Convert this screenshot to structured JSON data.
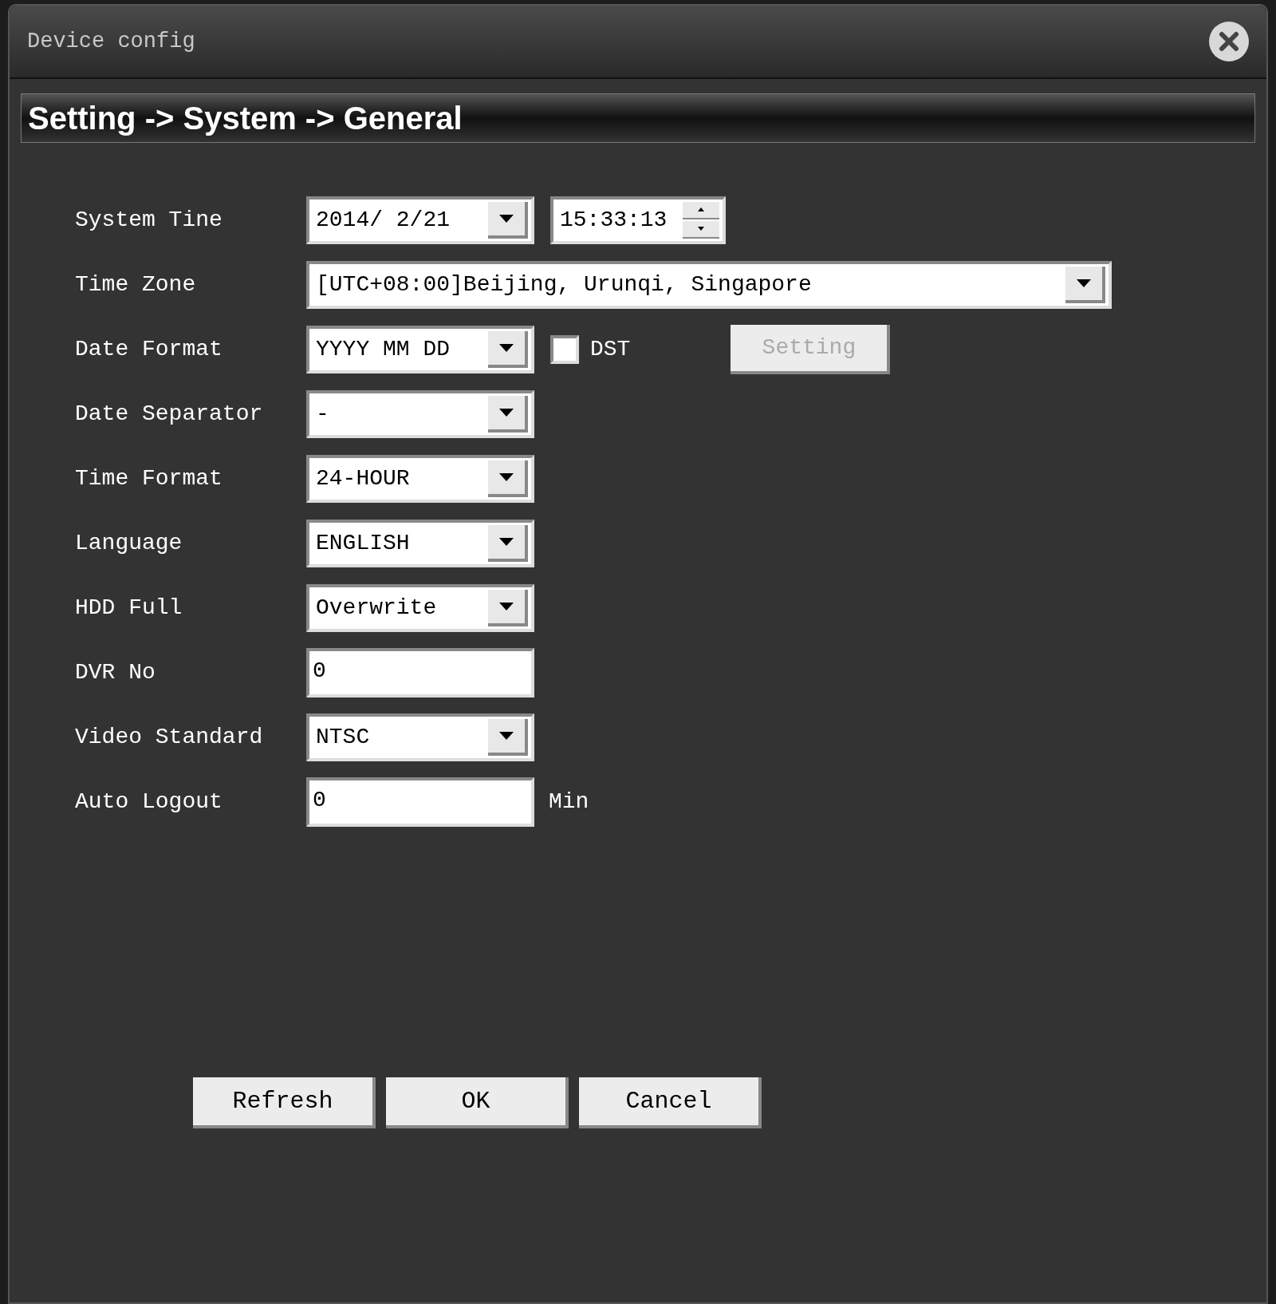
{
  "window": {
    "title": "Device config"
  },
  "header": "Setting -> System -> General",
  "rows": [
    {
      "label": "System Tine",
      "controls": [
        {
          "kind": "dropdown",
          "value": "2014/ 2/21"
        },
        {
          "kind": "spinner",
          "value": "15:33:13"
        }
      ]
    },
    {
      "label": "Time Zone",
      "controls": [
        {
          "kind": "wide-dropdown",
          "value": "[UTC+08:00]Beijing, Urunqi, Singapore"
        }
      ]
    },
    {
      "label": "Date Format",
      "controls": [
        {
          "kind": "dropdown",
          "value": "YYYY MM DD"
        },
        {
          "kind": "checkbox",
          "label": "DST",
          "checked": false
        },
        {
          "kind": "button",
          "label": "Setting",
          "disabled": true
        }
      ]
    },
    {
      "label": "Date Separator",
      "controls": [
        {
          "kind": "dropdown",
          "value": "-"
        }
      ]
    },
    {
      "label": "Time Format",
      "controls": [
        {
          "kind": "dropdown",
          "value": "24-HOUR"
        }
      ]
    },
    {
      "label": "Language",
      "controls": [
        {
          "kind": "dropdown",
          "value": "ENGLISH"
        }
      ]
    },
    {
      "label": "HDD Full",
      "controls": [
        {
          "kind": "dropdown",
          "value": "Overwrite"
        }
      ]
    },
    {
      "label": "DVR No",
      "controls": [
        {
          "kind": "text",
          "value": "0"
        }
      ]
    },
    {
      "label": "Video Standard",
      "controls": [
        {
          "kind": "dropdown",
          "value": "NTSC"
        }
      ]
    },
    {
      "label": "Auto Logout",
      "controls": [
        {
          "kind": "text",
          "value": "0"
        },
        {
          "kind": "unit",
          "label": "Min"
        }
      ]
    }
  ],
  "buttons": [
    "Refresh",
    "OK",
    "Cancel"
  ]
}
